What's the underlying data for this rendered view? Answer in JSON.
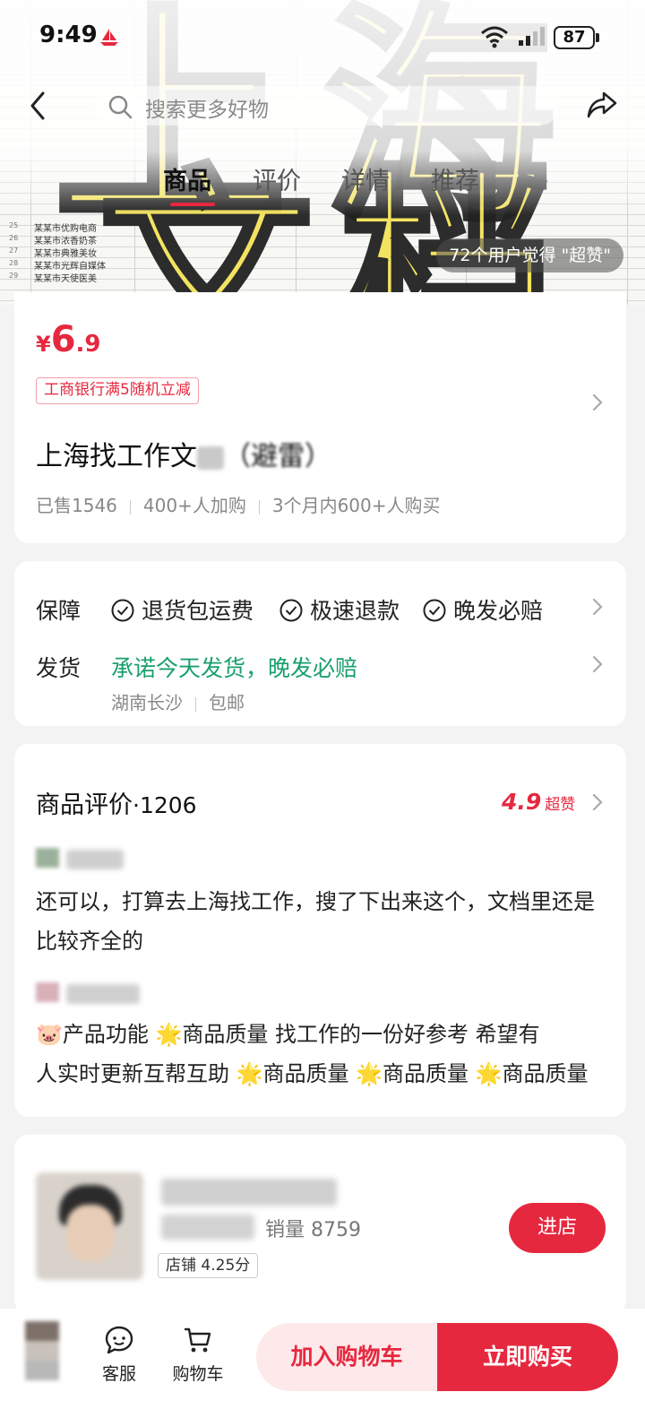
{
  "status_bar": {
    "time": "9:49",
    "battery": "87"
  },
  "nav": {
    "search_placeholder": "搜索更多好物"
  },
  "tabs": [
    {
      "label": "商品",
      "active": true
    },
    {
      "label": "评价",
      "active": false
    },
    {
      "label": "详情",
      "active": false
    },
    {
      "label": "推荐",
      "active": false
    }
  ],
  "hero": {
    "badge": "72个用户觉得 \"超赞\"",
    "sheet_rows": [
      {
        "n": "25",
        "name": "某某市优购电商"
      },
      {
        "n": "26",
        "name": "某某市浓香奶茶"
      },
      {
        "n": "27",
        "name": "某某市典雅美妆"
      },
      {
        "n": "28",
        "name": "某某市光辉自媒体"
      },
      {
        "n": "29",
        "name": "某某市天使医美"
      }
    ]
  },
  "product": {
    "price_currency": "¥",
    "price_int": "6",
    "price_dec": ".9",
    "promo": "工商银行满5随机立减",
    "title_visible": "上海找工作文",
    "title_tail": "（避雷）",
    "sold": "已售1546",
    "added_to_cart": "400+人加购",
    "recent_buyers": "3个月内600+人购买"
  },
  "service": {
    "guarantee_label": "保障",
    "guarantees": [
      "退货包运费",
      "极速退款",
      "晚发必赔"
    ],
    "shipping_label": "发货",
    "shipping_promise": "承诺今天发货，晚发必赔",
    "origin": "湖南长沙",
    "postage": "包邮"
  },
  "reviews": {
    "title": "商品评价",
    "count": "·1206",
    "score": "4.9",
    "score_tag": "超赞",
    "items": [
      {
        "text": "还可以，打算去上海找工作，搜了下出来这个，文档里还是比较齐全的"
      },
      {
        "line1": "🐷产品功能 🌟商品质量 找工作的一份好参考 希望有",
        "line2": "人实时更新互帮互助 🌟商品质量 🌟商品质量 🌟商品质量"
      }
    ]
  },
  "shop": {
    "sales": "销量 8759",
    "rating": "店铺  4.25分",
    "visit_label": "进店"
  },
  "bottom_bar": {
    "service_label": "客服",
    "cart_label": "购物车",
    "add_to_cart": "加入购物车",
    "buy_now": "立即购买"
  },
  "colors": {
    "accent": "#e6283f",
    "green": "#18a06c"
  }
}
